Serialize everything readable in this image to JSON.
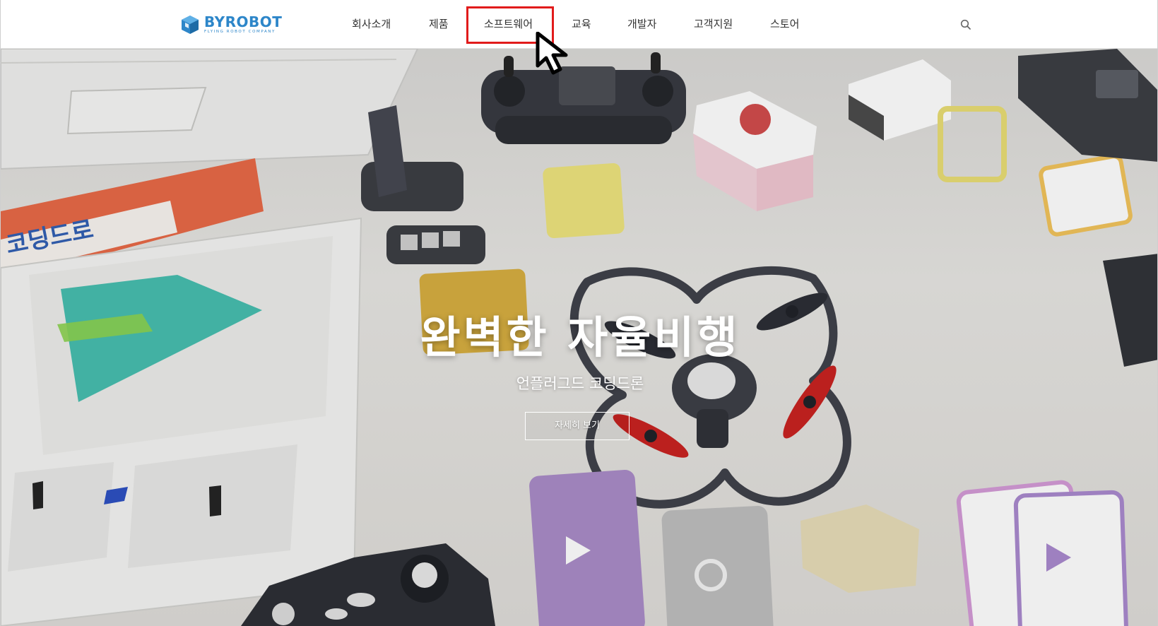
{
  "header": {
    "logo": {
      "text": "BYROBOT",
      "subtext": "FLYING ROBOT COMPANY"
    },
    "nav": [
      {
        "label": "회사소개"
      },
      {
        "label": "제품"
      },
      {
        "label": "소프트웨어",
        "highlighted": true
      },
      {
        "label": "교육"
      },
      {
        "label": "개발자"
      },
      {
        "label": "고객지원"
      },
      {
        "label": "스토어"
      }
    ],
    "search_icon": "search-icon"
  },
  "hero": {
    "title": "완벽한 자율비행",
    "subtitle": "언플러그드 코딩드론",
    "cta_label": "자세히 보기"
  },
  "colors": {
    "brand": "#2d86c9",
    "highlight": "#e11b1b",
    "drone_propeller": "#c8201e"
  }
}
